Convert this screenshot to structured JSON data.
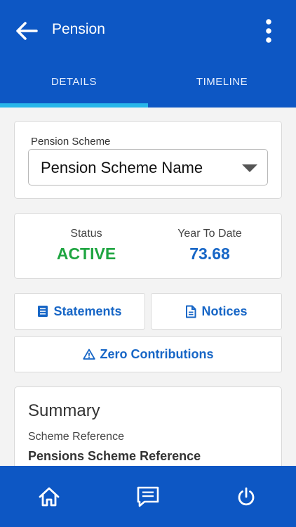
{
  "header": {
    "title": "Pension",
    "back_icon": "arrow-left-icon",
    "menu_icon": "more-vertical-icon",
    "background_color": "#0d57c4"
  },
  "tabs": [
    {
      "label": "DETAILS",
      "selected": true
    },
    {
      "label": "TIMELINE",
      "selected": false
    }
  ],
  "scheme": {
    "label": "Pension Scheme",
    "selected_value": "Pension Scheme Name"
  },
  "status": {
    "status_label": "Status",
    "status_value": "ACTIVE",
    "status_color": "#1fa541",
    "ytd_label": "Year To Date",
    "ytd_value": "73.68",
    "ytd_color": "#1766c6"
  },
  "actions": {
    "statements_label": "Statements",
    "statements_icon": "statement-icon",
    "notices_label": "Notices",
    "notices_icon": "document-icon",
    "zero_label": "Zero Contributions",
    "zero_icon": "warning-icon"
  },
  "summary": {
    "title": "Summary",
    "reference_label": "Scheme Reference",
    "reference_value": "Pensions Scheme Reference"
  },
  "bottom_nav": [
    {
      "icon": "home-icon"
    },
    {
      "icon": "message-icon"
    },
    {
      "icon": "power-icon"
    }
  ]
}
